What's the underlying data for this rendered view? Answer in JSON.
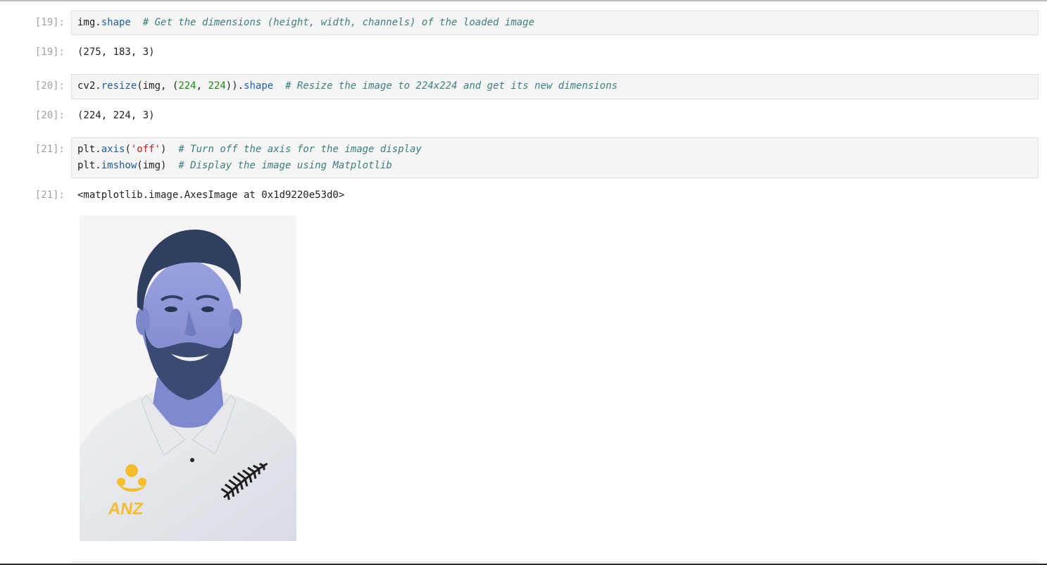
{
  "cells": [
    {
      "in_prompt": "[19]:",
      "code_lines": [
        [
          {
            "t": "img.",
            "c": ""
          },
          {
            "t": "shape",
            "c": "attr"
          },
          {
            "t": "  ",
            "c": ""
          },
          {
            "t": "# Get the dimensions (height, width, channels) of the loaded image",
            "c": "cmt"
          }
        ]
      ],
      "out_prompt": "[19]:",
      "output": "(275, 183, 3)"
    },
    {
      "in_prompt": "[20]:",
      "code_lines": [
        [
          {
            "t": "cv2.",
            "c": ""
          },
          {
            "t": "resize",
            "c": "attr"
          },
          {
            "t": "(img, (",
            "c": ""
          },
          {
            "t": "224",
            "c": "num"
          },
          {
            "t": ", ",
            "c": ""
          },
          {
            "t": "224",
            "c": "num"
          },
          {
            "t": ")).",
            "c": ""
          },
          {
            "t": "shape",
            "c": "attr"
          },
          {
            "t": "  ",
            "c": ""
          },
          {
            "t": "# Resize the image to 224x224 and get its new dimensions",
            "c": "cmt"
          }
        ]
      ],
      "out_prompt": "[20]:",
      "output": "(224, 224, 3)"
    },
    {
      "in_prompt": "[21]:",
      "code_lines": [
        [
          {
            "t": "plt.",
            "c": ""
          },
          {
            "t": "axis",
            "c": "attr"
          },
          {
            "t": "(",
            "c": ""
          },
          {
            "t": "'off'",
            "c": "str"
          },
          {
            "t": ")  ",
            "c": ""
          },
          {
            "t": "# Turn off the axis for the image display",
            "c": "cmt"
          }
        ],
        [
          {
            "t": "plt.",
            "c": ""
          },
          {
            "t": "imshow",
            "c": "attr"
          },
          {
            "t": "(img)  ",
            "c": ""
          },
          {
            "t": "# Display the image using Matplotlib",
            "c": "cmt"
          }
        ]
      ],
      "out_prompt": "[21]:",
      "output": "<matplotlib.image.AxesImage at 0x1d9220e53d0>"
    }
  ],
  "plot_image": {
    "subject": "portrait-photo",
    "logo_text": "ANZ",
    "colors": {
      "background": "#f7f4f5",
      "skin": "#8a93d6",
      "hair": "#2e3f60",
      "beard": "#3a4a73",
      "shirt": "#f0f1f3",
      "logo": "#f3be2c",
      "fern": "#1e1e1e"
    }
  }
}
